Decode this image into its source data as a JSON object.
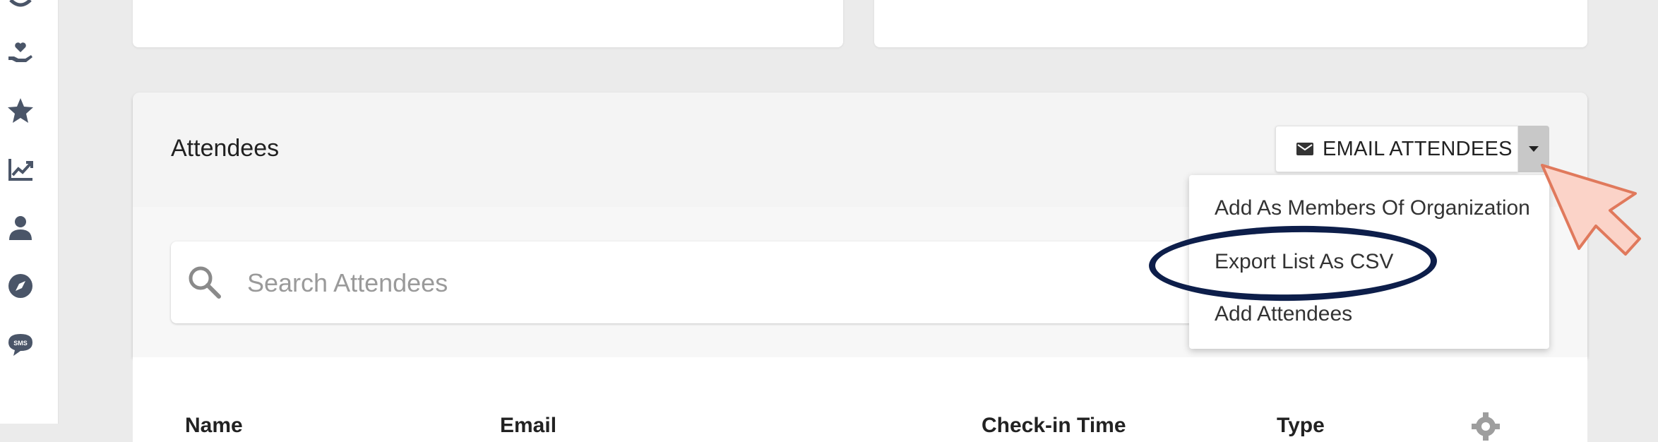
{
  "header": {
    "title": "Attendees"
  },
  "actions": {
    "email_label": "EMAIL ATTENDEES",
    "menu_items": [
      "Add As Members Of Organization",
      "Export List As CSV",
      "Add Attendees"
    ]
  },
  "search": {
    "placeholder": "Search Attendees"
  },
  "table": {
    "columns": [
      "Name",
      "Email",
      "Check-in Time",
      "Type"
    ]
  },
  "sidebar": {
    "icons": [
      "donation-hand-icon",
      "star-icon",
      "chart-line-icon",
      "person-icon",
      "compass-icon",
      "sms-icon"
    ]
  },
  "colors": {
    "background": "#ebebeb",
    "sidebar_icon": "#4a5568",
    "highlight_ring": "#0d1e4a",
    "cursor_fill": "#fbd3c8",
    "cursor_stroke": "#e0795c"
  }
}
